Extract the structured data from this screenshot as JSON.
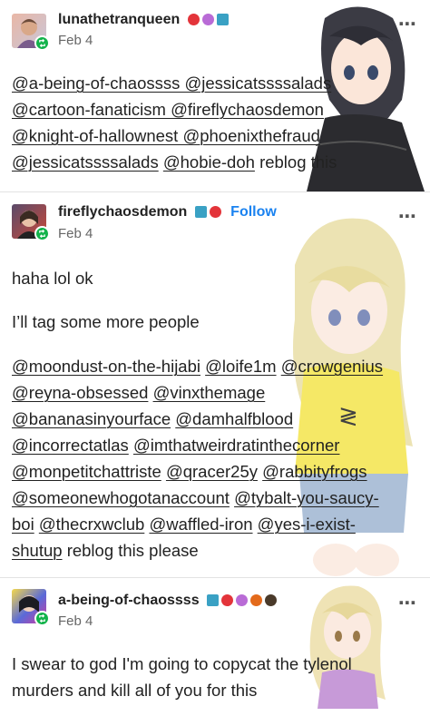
{
  "posts": [
    {
      "username": "lunathetranqueen",
      "date": "Feb 4",
      "mentions_line1": "@a-being-of-chaossss @jessicatssssalads",
      "mentions_line2": "@cartoon-fanaticism @fireflychaosdemon",
      "mentions_line3": "@knight-of-hallownest @phoenixthefraud",
      "mentions_line4a": "@jessicatssssalads",
      "mentions_line4b": "@hobie-doh",
      "tail": "reblog this",
      "badge_colors": [
        "#e3343a",
        "#b96bd6",
        "#3aa1c4"
      ]
    },
    {
      "username": "fireflychaosdemon",
      "follow_label": "Follow",
      "date": "Feb 4",
      "line1": "haha lol ok",
      "line2": "I’ll tag some more people",
      "mentions": [
        [
          "@moondust-on-the-hijabi",
          "@loife1m",
          "@crowgenius"
        ],
        [
          "@reyna-obsessed",
          "@vinxthemage"
        ],
        [
          "@bananasinyourface",
          "@damhalfblood"
        ],
        [
          "@incorrectatlas",
          "@imthatweirdratinthecorner"
        ],
        [
          "@monpetitchattriste",
          "@qracer25y",
          "@rabbityfrogs"
        ],
        [
          "@someonewhogotanaccount",
          "@tybalt-you-saucy-"
        ],
        [
          "boi",
          "@thecrxwclub",
          "@waffled-iron",
          "@yes-i-exist-"
        ],
        [
          "shutup"
        ]
      ],
      "tail": "reblog this please",
      "badge_colors": [
        "#3aa1c4",
        "#e3343a"
      ]
    },
    {
      "username": "a-being-of-chaossss",
      "date": "Feb 4",
      "text_line1": "I swear to god I'm going to copycat the tylenol",
      "text_line2": "murders and kill all of you for this",
      "badge_colors": [
        "#3aa1c4",
        "#e3343a",
        "#b96bd6",
        "#e36a1b",
        "#4a3a2a"
      ]
    }
  ],
  "more_icon": "⋯",
  "accent_follow": "#1a82f0",
  "reblog_green": "#13b34b"
}
